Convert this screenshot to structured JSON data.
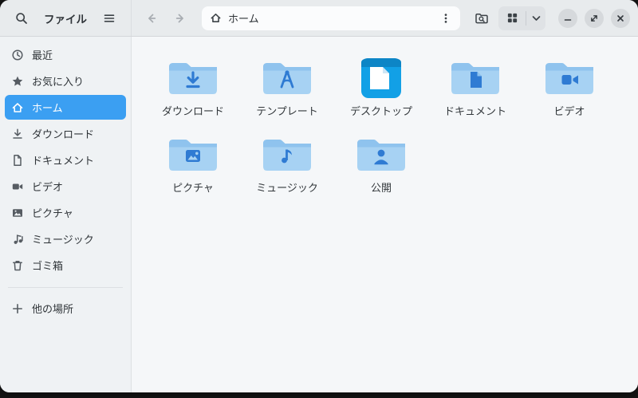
{
  "window": {
    "app_title": "ファイル",
    "path_label": "ホーム"
  },
  "sidebar": {
    "items": [
      {
        "label": "最近",
        "icon": "recent-icon"
      },
      {
        "label": "お気に入り",
        "icon": "star-icon"
      },
      {
        "label": "ホーム",
        "icon": "home-icon",
        "selected": true
      },
      {
        "label": "ダウンロード",
        "icon": "download-icon"
      },
      {
        "label": "ドキュメント",
        "icon": "document-icon"
      },
      {
        "label": "ビデオ",
        "icon": "video-icon"
      },
      {
        "label": "ピクチャ",
        "icon": "picture-icon"
      },
      {
        "label": "ミュージック",
        "icon": "music-icon"
      },
      {
        "label": "ゴミ箱",
        "icon": "trash-icon"
      }
    ],
    "other_locations": "他の場所"
  },
  "files": [
    {
      "label": "ダウンロード",
      "emblem": "download"
    },
    {
      "label": "テンプレート",
      "emblem": "template"
    },
    {
      "label": "デスクトップ",
      "emblem": "desktop"
    },
    {
      "label": "ドキュメント",
      "emblem": "document"
    },
    {
      "label": "ビデオ",
      "emblem": "video"
    },
    {
      "label": "ピクチャ",
      "emblem": "picture"
    },
    {
      "label": "ミュージック",
      "emblem": "music"
    },
    {
      "label": "公開",
      "emblem": "public"
    }
  ],
  "colors": {
    "accent": "#3b9ff2",
    "header_bg": "#e8ebed",
    "sidebar_bg": "#eff2f4",
    "main_bg": "#f5f7f9",
    "folder_body": "#a7d2f3",
    "folder_tab": "#8fc3ee",
    "emblem": "#2f7bd3",
    "desktop_blue": "#12a0e6"
  }
}
